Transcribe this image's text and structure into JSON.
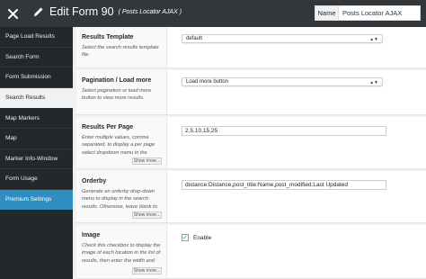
{
  "header": {
    "close_icon": "close-icon",
    "edit_icon": "pencil-icon",
    "title": "Edit Form 90",
    "subtitle": "( Posts Locator AJAX )",
    "name_label": "Name",
    "name_value": "Posts Locator AJAX"
  },
  "sidebar": {
    "items": [
      {
        "label": "Page Load Results"
      },
      {
        "label": "Search Form"
      },
      {
        "label": "Form Submission"
      },
      {
        "label": "Search Results"
      },
      {
        "label": "Map Markers"
      },
      {
        "label": "Map"
      },
      {
        "label": "Marker Info-Window"
      },
      {
        "label": "Form Usage"
      },
      {
        "label": "Premium Settings"
      }
    ],
    "active": "Search Results",
    "highlight": "Premium Settings",
    "highlight_color": "#2e8ec2"
  },
  "settings": {
    "results_template": {
      "title": "Results Template",
      "desc": "Select the search results template file.",
      "value": "default"
    },
    "pagination": {
      "title": "Pagination / Load more",
      "desc": "Select pagination or load more button to view more results.",
      "value": "Load more button"
    },
    "results_per_page": {
      "title": "Results Per Page",
      "desc": "Enter multiple values, comma separated, to display a per page select dropdown menu in the",
      "show_more": "Show more...",
      "value": "2,5,10,15,25"
    },
    "orderby": {
      "title": "Orderby",
      "desc": "Generate an orderby drop-down menu to display in the search results. Otherwise, leave blank to",
      "show_more": "Show more...",
      "value": "distance:Distance,post_title:Name,post_modified:Last Updated"
    },
    "image": {
      "title": "Image",
      "desc": "Check this checkbox to display the image of each location in the list of results, then enter the width and",
      "show_more": "Show more...",
      "check_label": "Enable",
      "checked": true
    }
  }
}
